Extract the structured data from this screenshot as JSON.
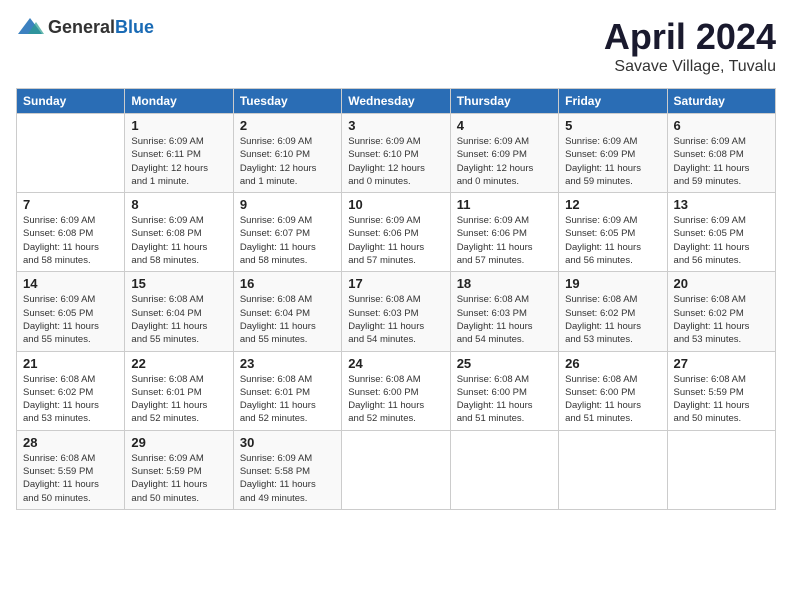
{
  "header": {
    "logo_general": "General",
    "logo_blue": "Blue",
    "title": "April 2024",
    "location": "Savave Village, Tuvalu"
  },
  "calendar": {
    "days_of_week": [
      "Sunday",
      "Monday",
      "Tuesday",
      "Wednesday",
      "Thursday",
      "Friday",
      "Saturday"
    ],
    "weeks": [
      [
        {
          "day": "",
          "detail": ""
        },
        {
          "day": "1",
          "detail": "Sunrise: 6:09 AM\nSunset: 6:11 PM\nDaylight: 12 hours\nand 1 minute."
        },
        {
          "day": "2",
          "detail": "Sunrise: 6:09 AM\nSunset: 6:10 PM\nDaylight: 12 hours\nand 1 minute."
        },
        {
          "day": "3",
          "detail": "Sunrise: 6:09 AM\nSunset: 6:10 PM\nDaylight: 12 hours\nand 0 minutes."
        },
        {
          "day": "4",
          "detail": "Sunrise: 6:09 AM\nSunset: 6:09 PM\nDaylight: 12 hours\nand 0 minutes."
        },
        {
          "day": "5",
          "detail": "Sunrise: 6:09 AM\nSunset: 6:09 PM\nDaylight: 11 hours\nand 59 minutes."
        },
        {
          "day": "6",
          "detail": "Sunrise: 6:09 AM\nSunset: 6:08 PM\nDaylight: 11 hours\nand 59 minutes."
        }
      ],
      [
        {
          "day": "7",
          "detail": "Sunrise: 6:09 AM\nSunset: 6:08 PM\nDaylight: 11 hours\nand 58 minutes."
        },
        {
          "day": "8",
          "detail": "Sunrise: 6:09 AM\nSunset: 6:08 PM\nDaylight: 11 hours\nand 58 minutes."
        },
        {
          "day": "9",
          "detail": "Sunrise: 6:09 AM\nSunset: 6:07 PM\nDaylight: 11 hours\nand 58 minutes."
        },
        {
          "day": "10",
          "detail": "Sunrise: 6:09 AM\nSunset: 6:06 PM\nDaylight: 11 hours\nand 57 minutes."
        },
        {
          "day": "11",
          "detail": "Sunrise: 6:09 AM\nSunset: 6:06 PM\nDaylight: 11 hours\nand 57 minutes."
        },
        {
          "day": "12",
          "detail": "Sunrise: 6:09 AM\nSunset: 6:05 PM\nDaylight: 11 hours\nand 56 minutes."
        },
        {
          "day": "13",
          "detail": "Sunrise: 6:09 AM\nSunset: 6:05 PM\nDaylight: 11 hours\nand 56 minutes."
        }
      ],
      [
        {
          "day": "14",
          "detail": "Sunrise: 6:09 AM\nSunset: 6:05 PM\nDaylight: 11 hours\nand 55 minutes."
        },
        {
          "day": "15",
          "detail": "Sunrise: 6:08 AM\nSunset: 6:04 PM\nDaylight: 11 hours\nand 55 minutes."
        },
        {
          "day": "16",
          "detail": "Sunrise: 6:08 AM\nSunset: 6:04 PM\nDaylight: 11 hours\nand 55 minutes."
        },
        {
          "day": "17",
          "detail": "Sunrise: 6:08 AM\nSunset: 6:03 PM\nDaylight: 11 hours\nand 54 minutes."
        },
        {
          "day": "18",
          "detail": "Sunrise: 6:08 AM\nSunset: 6:03 PM\nDaylight: 11 hours\nand 54 minutes."
        },
        {
          "day": "19",
          "detail": "Sunrise: 6:08 AM\nSunset: 6:02 PM\nDaylight: 11 hours\nand 53 minutes."
        },
        {
          "day": "20",
          "detail": "Sunrise: 6:08 AM\nSunset: 6:02 PM\nDaylight: 11 hours\nand 53 minutes."
        }
      ],
      [
        {
          "day": "21",
          "detail": "Sunrise: 6:08 AM\nSunset: 6:02 PM\nDaylight: 11 hours\nand 53 minutes."
        },
        {
          "day": "22",
          "detail": "Sunrise: 6:08 AM\nSunset: 6:01 PM\nDaylight: 11 hours\nand 52 minutes."
        },
        {
          "day": "23",
          "detail": "Sunrise: 6:08 AM\nSunset: 6:01 PM\nDaylight: 11 hours\nand 52 minutes."
        },
        {
          "day": "24",
          "detail": "Sunrise: 6:08 AM\nSunset: 6:00 PM\nDaylight: 11 hours\nand 52 minutes."
        },
        {
          "day": "25",
          "detail": "Sunrise: 6:08 AM\nSunset: 6:00 PM\nDaylight: 11 hours\nand 51 minutes."
        },
        {
          "day": "26",
          "detail": "Sunrise: 6:08 AM\nSunset: 6:00 PM\nDaylight: 11 hours\nand 51 minutes."
        },
        {
          "day": "27",
          "detail": "Sunrise: 6:08 AM\nSunset: 5:59 PM\nDaylight: 11 hours\nand 50 minutes."
        }
      ],
      [
        {
          "day": "28",
          "detail": "Sunrise: 6:08 AM\nSunset: 5:59 PM\nDaylight: 11 hours\nand 50 minutes."
        },
        {
          "day": "29",
          "detail": "Sunrise: 6:09 AM\nSunset: 5:59 PM\nDaylight: 11 hours\nand 50 minutes."
        },
        {
          "day": "30",
          "detail": "Sunrise: 6:09 AM\nSunset: 5:58 PM\nDaylight: 11 hours\nand 49 minutes."
        },
        {
          "day": "",
          "detail": ""
        },
        {
          "day": "",
          "detail": ""
        },
        {
          "day": "",
          "detail": ""
        },
        {
          "day": "",
          "detail": ""
        }
      ]
    ]
  }
}
